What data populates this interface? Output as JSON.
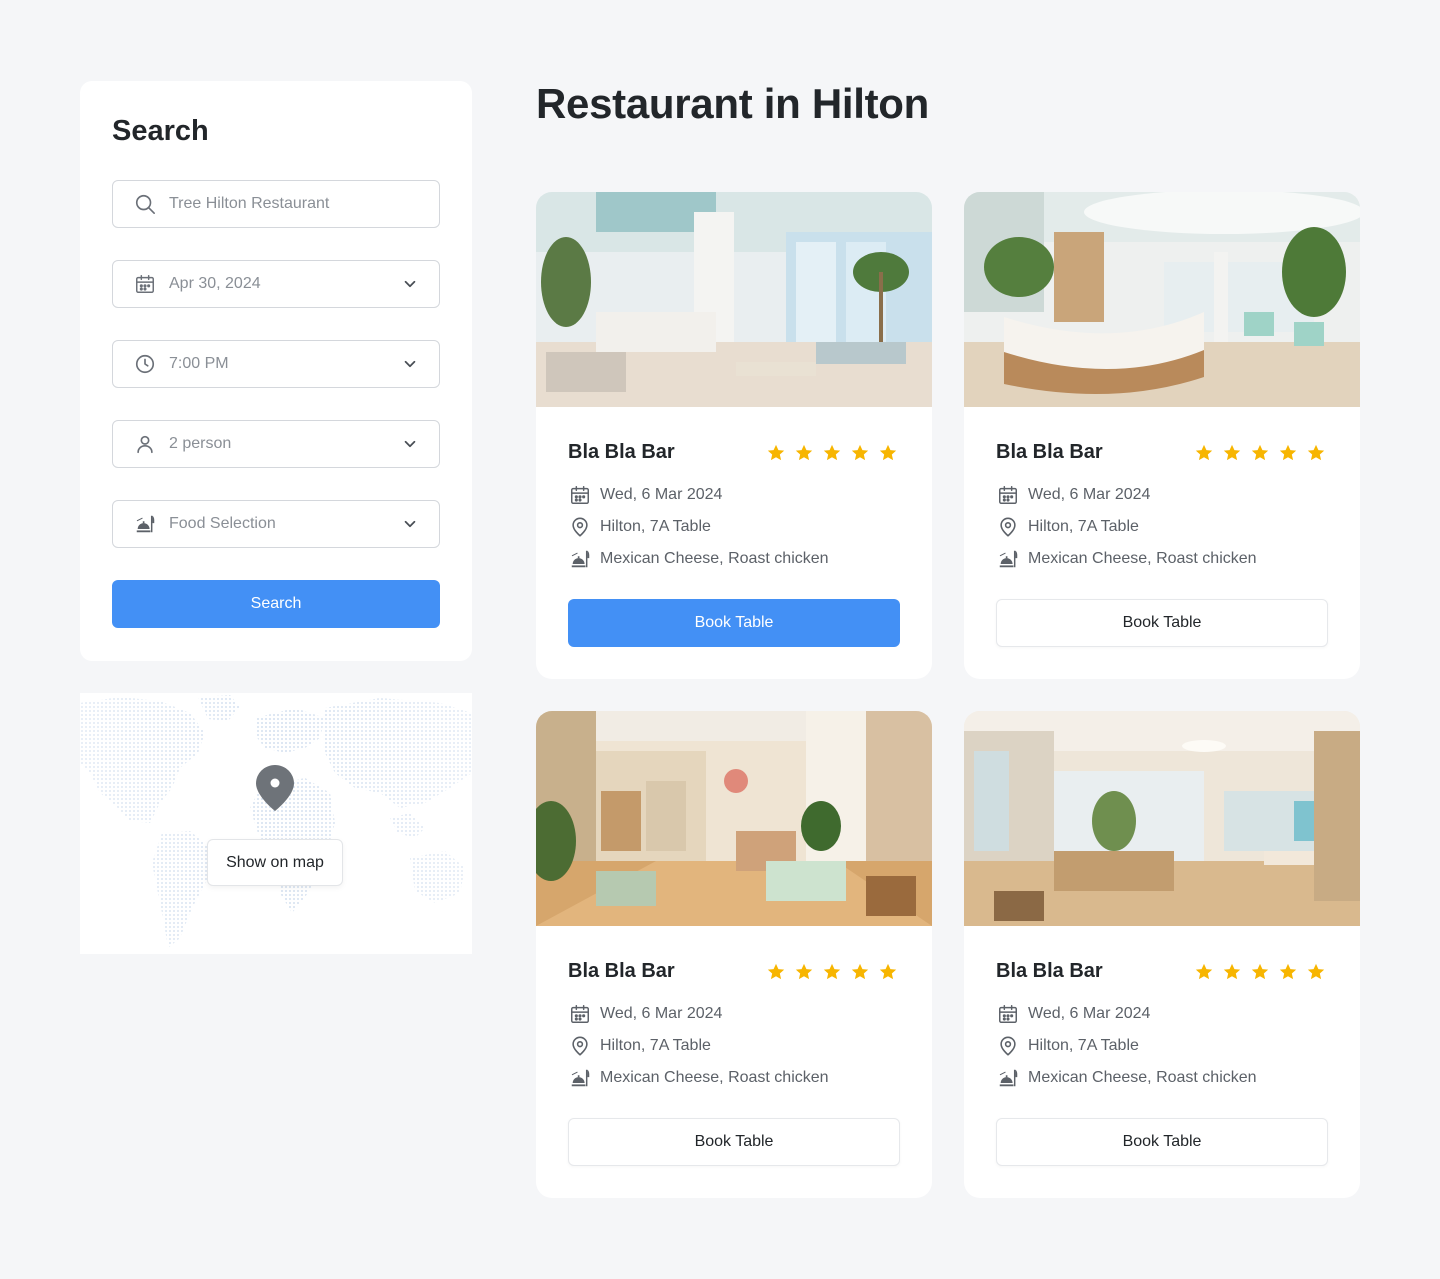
{
  "search": {
    "title": "Search",
    "query_placeholder": "Tree Hilton Restaurant",
    "date": "Apr 30, 2024",
    "time": "7:00 PM",
    "guests": "2 person",
    "food": "Food Selection",
    "button_label": "Search"
  },
  "map": {
    "button_label": "Show on map"
  },
  "page_title": "Restaurant in Hilton",
  "colors": {
    "accent": "#4390f5",
    "star": "#f7b500",
    "background": "#f5f6f8"
  },
  "cards": [
    {
      "name": "Bla Bla Bar",
      "rating": 5,
      "date": "Wed, 6 Mar 2024",
      "location": "Hilton, 7A Table",
      "food": "Mexican Cheese, Roast chicken",
      "button_label": "Book Table",
      "button_style": "primary",
      "photo": "bright-lobby-interior"
    },
    {
      "name": "Bla Bla Bar",
      "rating": 5,
      "date": "Wed, 6 Mar 2024",
      "location": "Hilton, 7A Table",
      "food": "Mexican Cheese, Roast chicken",
      "button_label": "Book Table",
      "button_style": "secondary",
      "photo": "reception-desk-interior"
    },
    {
      "name": "Bla Bla Bar",
      "rating": 5,
      "date": "Wed, 6 Mar 2024",
      "location": "Hilton, 7A Table",
      "food": "Mexican Cheese, Roast chicken",
      "button_label": "Book Table",
      "button_style": "secondary",
      "photo": "lounge-corridor-interior"
    },
    {
      "name": "Bla Bla Bar",
      "rating": 5,
      "date": "Wed, 6 Mar 2024",
      "location": "Hilton, 7A Table",
      "food": "Mexican Cheese, Roast chicken",
      "button_label": "Book Table",
      "button_style": "secondary",
      "photo": "dining-hall-interior"
    }
  ]
}
